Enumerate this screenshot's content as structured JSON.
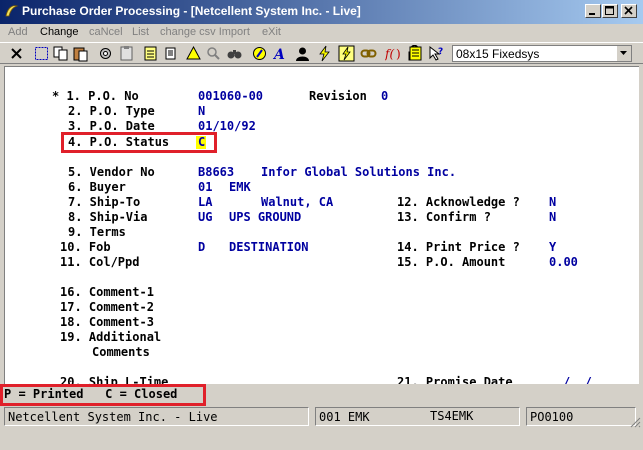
{
  "window": {
    "title": "Purchase Order Processing - [Netcellent System Inc. - Live]"
  },
  "menu": {
    "items": [
      {
        "label": "Add",
        "enabled": false
      },
      {
        "label": "Change",
        "enabled": true
      },
      {
        "label": "caNcel",
        "enabled": false
      },
      {
        "label": "List",
        "enabled": false
      },
      {
        "label": "change csv Import",
        "enabled": false
      },
      {
        "label": "eXit",
        "enabled": false
      }
    ]
  },
  "toolbar": {
    "icons": [
      "close-icon",
      "select-icon",
      "copy-icon",
      "paste-icon",
      "settings-icon",
      "clipboard-icon",
      "calendar-icon",
      "bell-icon",
      "search-icon",
      "binoculars-icon",
      "help-icon",
      "globe-icon",
      "font-icon",
      "user-icon",
      "lightning-icon",
      "lightning-alt-icon",
      "link-icon",
      "function-icon",
      "lock-icon",
      "notes-icon",
      "context-help-icon"
    ],
    "font_select": "08x15 Fixedsys"
  },
  "form": {
    "po_no_label": "* 1. P.O. No",
    "po_no": "001060-00",
    "revision_label": "Revision",
    "revision": "0",
    "po_type_label": "2. P.O. Type",
    "po_type": "N",
    "po_date_label": "3. P.O. Date",
    "po_date": "01/10/92",
    "po_status_label": "4. P.O. Status",
    "po_status": "C",
    "vendor_no_label": "5. Vendor No",
    "vendor_no": "B8663",
    "vendor_name": "Infor Global Solutions Inc.",
    "buyer_label": "6. Buyer",
    "buyer_code": "01",
    "buyer_name": "EMK",
    "ship_to_label": "7. Ship-To",
    "ship_to_code": "LA",
    "ship_to_name": "Walnut, CA",
    "ship_via_label": "8. Ship-Via",
    "ship_via_code": "UG",
    "ship_via_name": "UPS GROUND",
    "terms_label": "9. Terms",
    "fob_label": "10. Fob",
    "fob_code": "D",
    "fob_name": "DESTINATION",
    "col_ppd_label": "11. Col/Ppd",
    "acknowledge_label": "12. Acknowledge ?",
    "acknowledge": "N",
    "confirm_label": "13. Confirm ?",
    "confirm": "N",
    "print_price_label": "14. Print Price ?",
    "print_price": "Y",
    "po_amount_label": "15. P.O. Amount",
    "po_amount": "0.00",
    "comment1_label": "16. Comment-1",
    "comment2_label": "17. Comment-2",
    "comment3_label": "18. Comment-3",
    "additional_label": "19. Additional",
    "comments_label": "Comments",
    "ship_l_time_label": "20. Ship L-Time",
    "promise_date_label": "21. Promise Date",
    "promise_date": "/  /"
  },
  "help_line": "P = Printed   C = Closed",
  "statusbar": {
    "company": "Netcellent System Inc. - Live",
    "user": "001 EMK",
    "terminal": "TS4EMK",
    "program": "PO0100"
  },
  "colors": {
    "highlight_box": "#e0202a",
    "cursor": "#ffff00",
    "title_start": "#0a246a"
  }
}
